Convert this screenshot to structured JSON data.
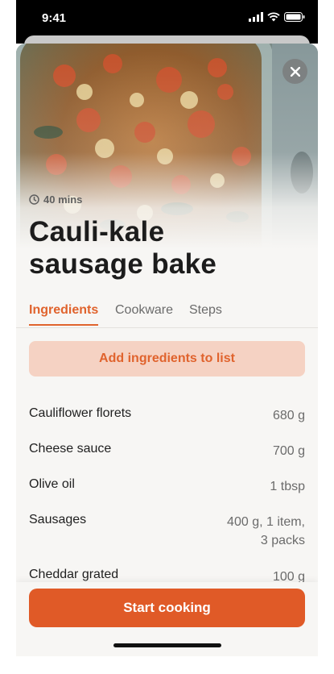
{
  "status_bar": {
    "time": "9:41"
  },
  "recipe": {
    "time": "40 mins",
    "title": "Cauli-kale sausage bake"
  },
  "tabs": [
    {
      "label": "Ingredients",
      "active": true
    },
    {
      "label": "Cookware",
      "active": false
    },
    {
      "label": "Steps",
      "active": false
    }
  ],
  "add_button_label": "Add ingredients to list",
  "ingredients": [
    {
      "name": "Cauliflower florets",
      "qty": "680 g"
    },
    {
      "name": "Cheese sauce",
      "qty": "700 g"
    },
    {
      "name": "Olive oil",
      "qty": "1 tbsp"
    },
    {
      "name": "Sausages",
      "qty": "400 g, 1 item,\n3 packs"
    },
    {
      "name": "Cheddar grated",
      "qty": "100 g"
    }
  ],
  "start_button_label": "Start cooking",
  "colors": {
    "accent": "#e05a27",
    "accent_light": "#f5d2c3",
    "background": "#f7f6f4"
  },
  "icons": {
    "close": "close-icon",
    "clock": "clock-icon"
  }
}
